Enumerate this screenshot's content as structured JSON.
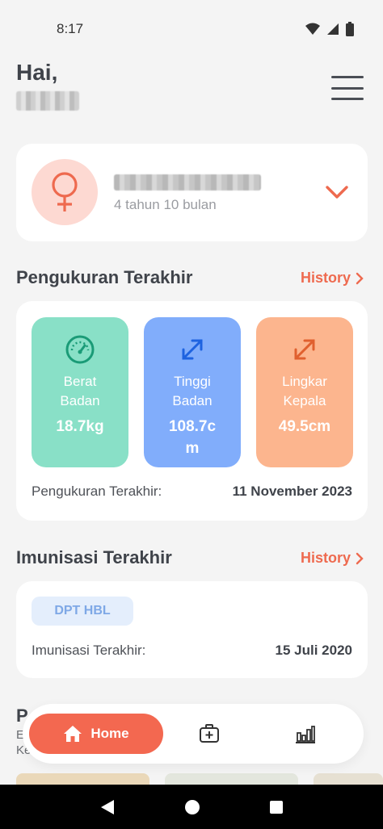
{
  "status_bar": {
    "time": "8:17"
  },
  "header": {
    "greeting": "Hai,"
  },
  "child": {
    "age": "4 tahun 10 bulan"
  },
  "measurement": {
    "title": "Pengukuran Terakhir",
    "history_label": "History",
    "tiles": [
      {
        "label_line1": "Berat",
        "label_line2": "Badan",
        "value": "18.7kg"
      },
      {
        "label_line1": "Tinggi",
        "label_line2": "Badan",
        "value": "108.7cm"
      },
      {
        "label_line1": "Lingkar",
        "label_line2": "Kepala",
        "value": "49.5cm"
      }
    ],
    "last_label": "Pengukuran Terakhir:",
    "last_date": "11 November 2023"
  },
  "immunization": {
    "title": "Imunisasi Terakhir",
    "history_label": "History",
    "vaccine": "DPT HBL",
    "last_label": "Imunisasi Terakhir:",
    "last_date": "15 Juli 2020"
  },
  "next_section": {
    "title_partial": "P",
    "line1_partial": "E",
    "line2_partial": "Ke"
  },
  "bottom_nav": {
    "home_label": "Home"
  },
  "colors": {
    "accent": "#f36850",
    "weight_tile": "#89e0c7",
    "height_tile": "#81adfb",
    "head_tile": "#fcb58e",
    "female_icon": "#ee6a4f"
  }
}
